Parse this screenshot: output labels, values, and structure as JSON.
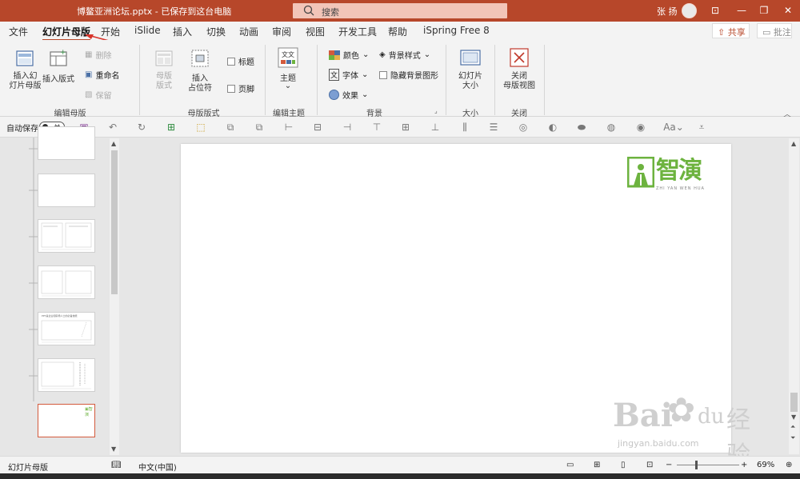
{
  "title": {
    "document": "博鳌亚洲论坛.pptx  -  已保存到这台电脑",
    "search_placeholder": "搜索",
    "user": "张 扬",
    "controls": [
      "—",
      "❐",
      "✕"
    ]
  },
  "menu": {
    "tabs": [
      "文件",
      "幻灯片母版",
      "开始",
      "iSlide",
      "插入",
      "切换",
      "动画",
      "审阅",
      "视图",
      "开发工具",
      "帮助",
      "iSpring Free 8"
    ],
    "share": "共享",
    "comment": "批注"
  },
  "ribbon": {
    "edit_master": {
      "insert_slide_master": "插入幻\n灯片母版",
      "insert_layout": "插入版式",
      "delete": "删除",
      "rename": "重命名",
      "preserve": "保留",
      "label": "编辑母版"
    },
    "master_layout": {
      "master_layout_btn": "母版\n版式",
      "insert_placeholder": "插入\n占位符",
      "title_check": "标题",
      "footer_check": "页脚",
      "label": "母版版式"
    },
    "edit_theme": {
      "themes": "主题",
      "label": "编辑主题"
    },
    "background": {
      "colors": "颜色",
      "fonts": "字体",
      "effects": "效果",
      "bg_styles": "背景样式",
      "hide_bg": "隐藏背景图形",
      "label": "背景"
    },
    "size": {
      "slide_size": "幻灯片\n大小",
      "label": "大小"
    },
    "close": {
      "close_master": "关闭\n母版视图",
      "label": "关闭"
    }
  },
  "qat": {
    "autosave": "自动保存",
    "toggle": "关"
  },
  "slide": {
    "logo_text": "智演",
    "logo_sub": "ZHI YAN WEN HUA",
    "thumb5_title": "PPT是企业和职场人士的必备技能"
  },
  "status": {
    "view": "幻灯片母版",
    "language": "中文(中国)",
    "zoom": "69%"
  },
  "watermark": {
    "brand": "Bai",
    "brand2": "du",
    "cn": "经验",
    "url": "jingyan.baidu.com"
  },
  "colors": {
    "accent": "#b7472a",
    "search_bg": "#f2c5b8",
    "logo_green": "#6db33f",
    "thumb_selected": "#d35a3c"
  }
}
